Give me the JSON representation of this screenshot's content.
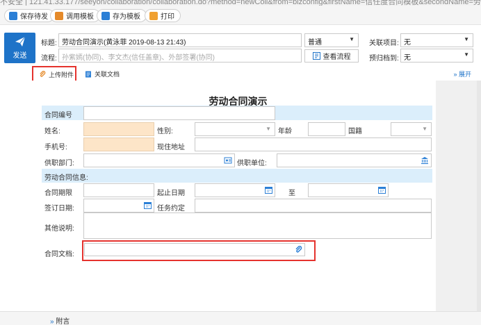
{
  "urlbar": {
    "text": "不安全 | 121.41.33.177/seeyon/collaboration/collaboration.do?method=newColl&from=bizconfig&firstName=信任度合同模板&secondName=劳"
  },
  "toolbar": {
    "save_draft": "保存待发",
    "use_template": "调用模板",
    "save_template": "存为模板",
    "print": "打印"
  },
  "header": {
    "send_label": "发送",
    "subject_label": "标题:",
    "subject_value": "劳动合同演示(黄泳菲 2019-08-13 21:43)",
    "flow_label": "流程:",
    "flow_placeholder": "孙紫嫣(协同)、李文杰(信任盖章)、外部签署(协同)",
    "priority_value": "普通",
    "view_flow": "查看流程",
    "related_project_label": "关联项目:",
    "related_project_value": "无",
    "archive_label": "预归档到:",
    "archive_value": "无"
  },
  "subbar": {
    "upload_attachment": "上传附件",
    "related_doc": "关联文档",
    "expand": "展开"
  },
  "form": {
    "title": "劳动合同演示",
    "contract_no": "合同编号",
    "name": "姓名:",
    "gender": "性别:",
    "age": "年龄",
    "nationality": "国籍",
    "phone": "手机号:",
    "current_address": "现住地址",
    "department": "供职部门:",
    "employer": "供职单位:",
    "contract_info": "劳动合同信息:",
    "contract_term": "合同期限",
    "start_end_date": "起止日期",
    "to": "至",
    "sign_date": "签订日期:",
    "task_agreement": "任务约定",
    "other_notes": "其他说明:",
    "contract_doc": "合同文档:"
  },
  "footer": {
    "appendix": "附言"
  },
  "colors": {
    "accent": "#1e73c8",
    "highlight": "#e5322d",
    "band": "#dbeefb",
    "peach": "#fde5c8"
  }
}
